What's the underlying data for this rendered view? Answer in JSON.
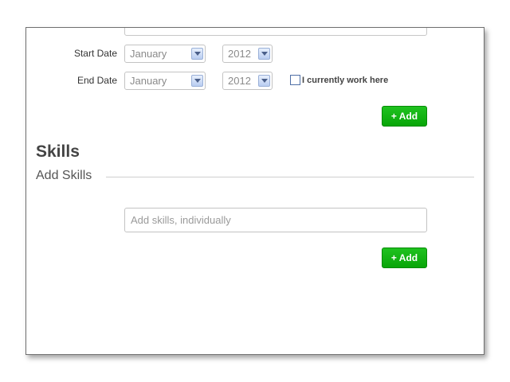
{
  "experience": {
    "start_date": {
      "label": "Start Date",
      "month": "January",
      "year": "2012"
    },
    "end_date": {
      "label": "End Date",
      "month": "January",
      "year": "2012"
    },
    "current_checkbox_label": "I currently work here",
    "add_button_label": "+ Add"
  },
  "skills": {
    "title": "Skills",
    "subtitle": "Add Skills",
    "input_placeholder": "Add skills, individually",
    "add_button_label": "+ Add"
  },
  "colors": {
    "accent": "#11b511",
    "text": "#444444"
  }
}
